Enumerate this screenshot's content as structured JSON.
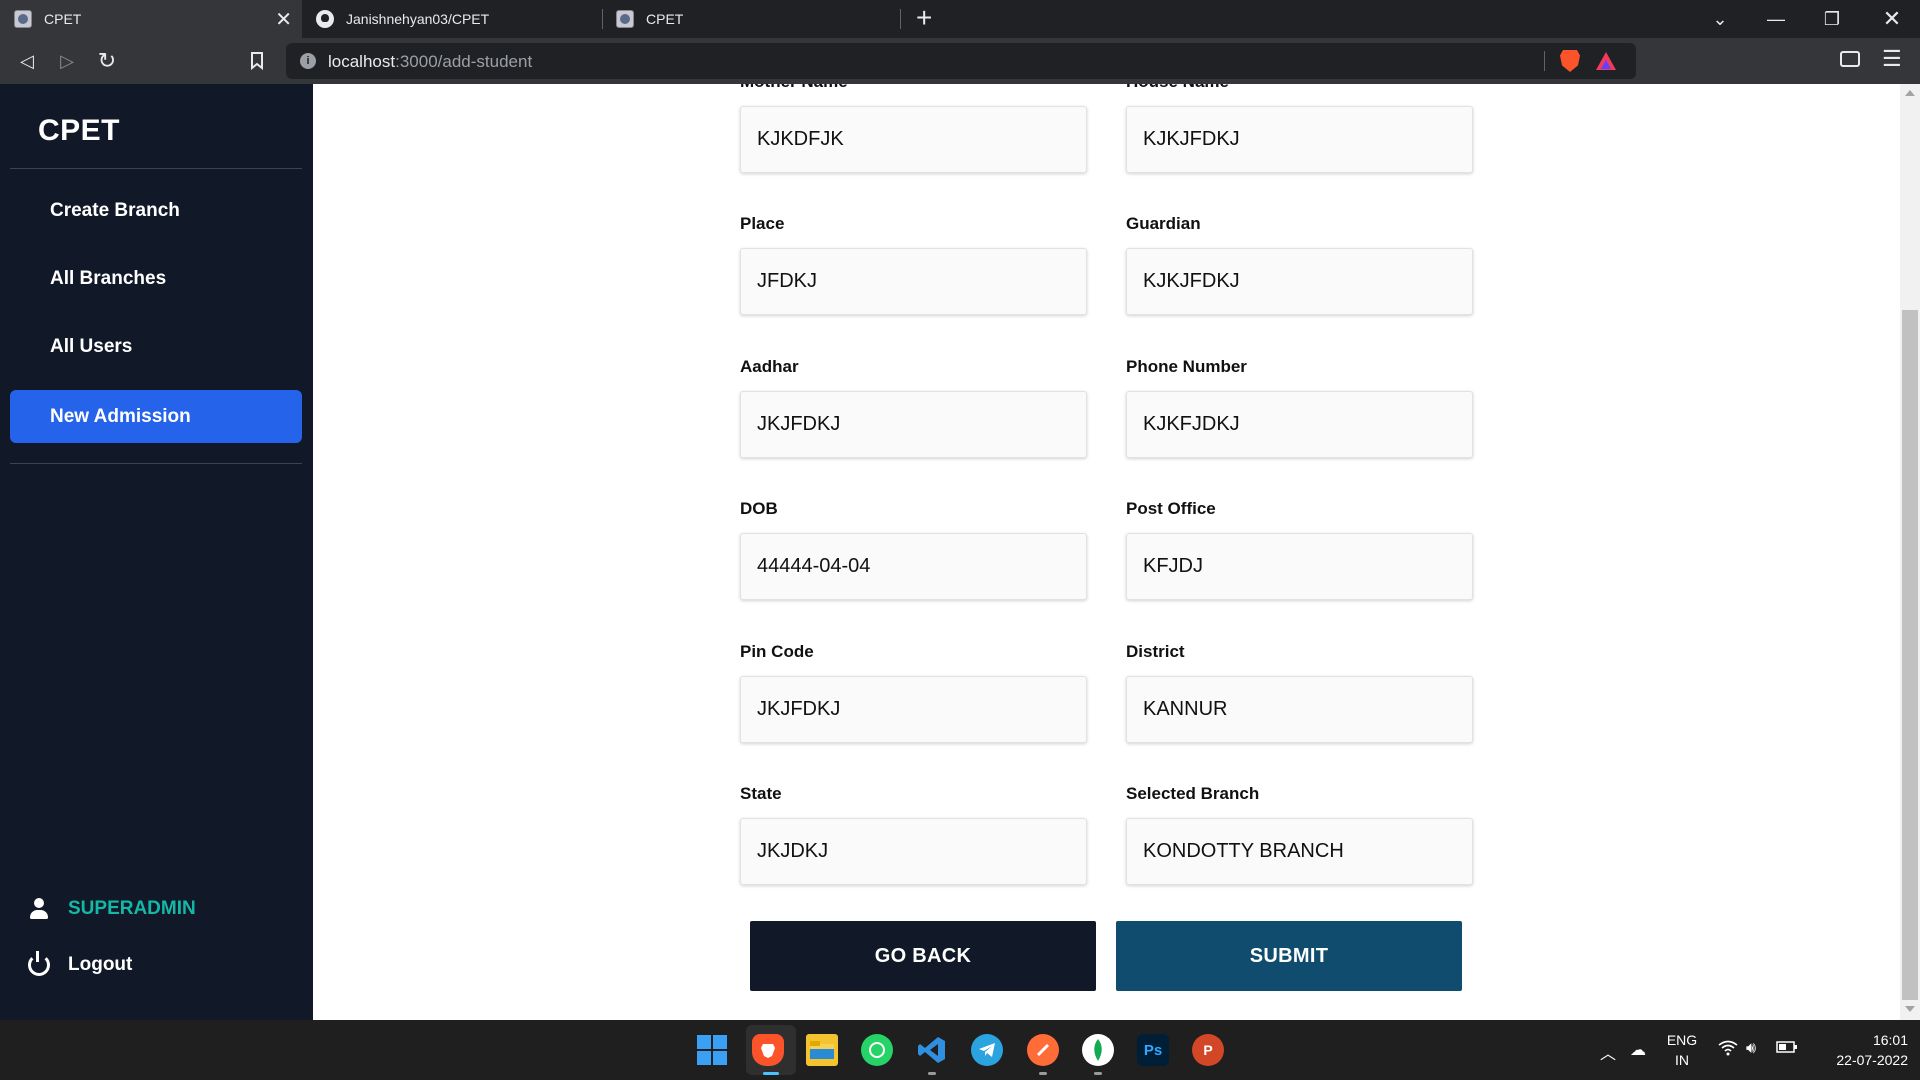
{
  "browser": {
    "tabs": [
      {
        "title": "CPET",
        "active": true
      },
      {
        "title": "Janishnehyan03/CPET",
        "active": false
      },
      {
        "title": "CPET",
        "active": false
      }
    ],
    "url_host": "localhost",
    "url_path": ":3000/add-student"
  },
  "sidebar": {
    "brand": "CPET",
    "items": [
      {
        "label": "Create Branch"
      },
      {
        "label": "All Branches"
      },
      {
        "label": "All Users"
      },
      {
        "label": "New Admission",
        "active": true
      }
    ],
    "user": "SUPERADMIN",
    "logout": "Logout"
  },
  "form": {
    "fields": [
      {
        "label": "Mother Name",
        "value": "KJKDFJK"
      },
      {
        "label": "House Name",
        "value": "KJKJFDKJ"
      },
      {
        "label": "Place",
        "value": "JFDKJ"
      },
      {
        "label": "Guardian",
        "value": "KJKJFDKJ"
      },
      {
        "label": "Aadhar",
        "value": "JKJFDKJ"
      },
      {
        "label": "Phone Number",
        "value": "KJKFJDKJ"
      },
      {
        "label": "DOB",
        "value": "44444-04-04"
      },
      {
        "label": "Post Office",
        "value": "KFJDJ"
      },
      {
        "label": "Pin Code",
        "value": "JKJFDKJ"
      },
      {
        "label": "District",
        "value": "KANNUR"
      },
      {
        "label": "State",
        "value": "JKJDKJ"
      },
      {
        "label": "Selected Branch",
        "value": "KONDOTTY BRANCH"
      }
    ],
    "go_back": "GO BACK",
    "submit": "SUBMIT"
  },
  "colors": {
    "sidebar_bg": "#111827",
    "active_item": "#2563eb",
    "user_accent": "#14b8a6",
    "submit_bg": "#0f4c6e",
    "back_bg": "#111827"
  },
  "taskbar": {
    "lang_top": "ENG",
    "lang_bottom": "IN",
    "time": "16:01",
    "date": "22-07-2022"
  }
}
